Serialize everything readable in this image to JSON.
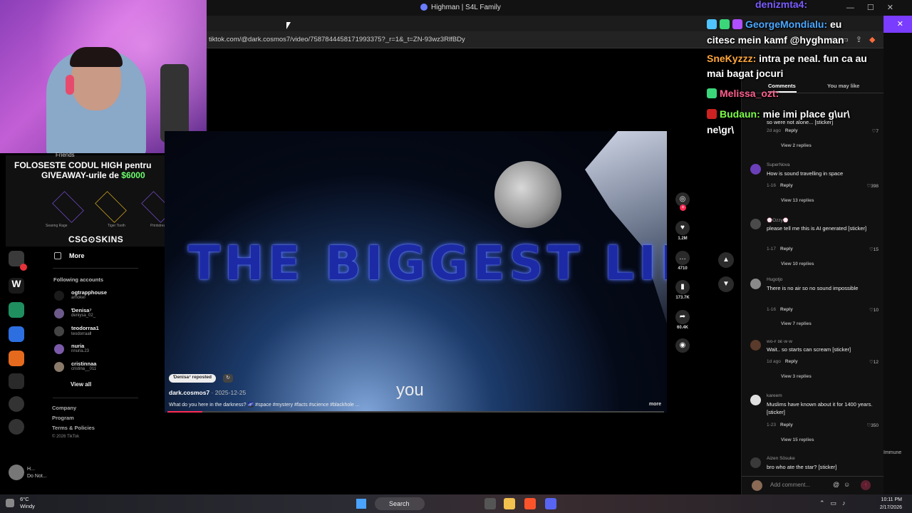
{
  "window": {
    "title": "Highman | S4L Family"
  },
  "browser": {
    "url": "tiktok.com/@dark.cosmos7/video/7587844458171993375?_r=1&_t=ZN-93wz3RlfBDy"
  },
  "giveaway": {
    "line1": "FOLOSESTE CODUL HIGH pentru",
    "line2_prefix": "GIVEAWAY-urile de ",
    "amount": "$6000",
    "items": [
      "Searing Rage",
      "Tiger Tooth",
      "Printstream"
    ],
    "brand": "CSG⊙SKINS"
  },
  "sidebar": {
    "friends": "Friends",
    "more": "More",
    "following_header": "Following accounts",
    "accounts": [
      {
        "name": "ogtrapphouse",
        "handle": "arhokel"
      },
      {
        "name": "Ɗenisa⁷",
        "handle": "deniysa_02_"
      },
      {
        "name": "teodorraa1",
        "handle": "teodorraaⅡ"
      },
      {
        "name": "nuria",
        "handle": "nnuria.23"
      },
      {
        "name": "cristinnaa",
        "handle": "cristina__011"
      }
    ],
    "view_all": "View all",
    "footer_links": [
      "Company",
      "Program",
      "Terms & Policies"
    ],
    "copyright": "© 2026 TikTok"
  },
  "video": {
    "overlay_title": "THE BIGGEST LIE",
    "subtitle": "you",
    "repost_chip": "Ɗenisa⁷ reposted",
    "author": "dark.cosmos7",
    "date": " · 2025-12-25",
    "caption": "What do you here in the darkness? 🌌 #space #mystery #facts #science #blackhole ...",
    "more": "more",
    "progress": 0.07
  },
  "actions": {
    "likes": "1.2M",
    "comments": "4710",
    "saves": "173.7K",
    "shares": "60.4K"
  },
  "comments_panel": {
    "tab_comments": "Comments",
    "tab_you_may_like": "You may like",
    "comments": [
      {
        "user": "",
        "text": "so were not alone... [sticker]",
        "meta": "2d ago",
        "reply": "Reply",
        "likes": "7",
        "view_replies": "View 2 replies"
      },
      {
        "user": "SuperNova",
        "text": "How is sound travelling in space",
        "meta": "1-16",
        "reply": "Reply",
        "likes": "398",
        "view_replies": "View 13 replies"
      },
      {
        "user": "💮Ozzy💮",
        "text": "please tell me this is AI generated [sticker]",
        "meta": "1-17",
        "reply": "Reply",
        "likes": "15",
        "view_replies": "View 10 replies"
      },
      {
        "user": "Hugotjo",
        "text": "There is no air so no sound impossible",
        "meta": "1-16",
        "reply": "Reply",
        "likes": "10",
        "view_replies": "View 7 replies"
      },
      {
        "user": "ᴡᴏ-ꜰ ᴅᴇ·ᴡ·ᴡ",
        "text": "Wait.. so starts can scream [sticker]",
        "meta": "1d ago",
        "reply": "Reply",
        "likes": "12",
        "view_replies": "View 3 replies"
      },
      {
        "user": "kareem",
        "text": "Muslims have known about it for 1400 years. [sticker]",
        "meta": "1-23",
        "reply": "Reply",
        "likes": "350",
        "view_replies": "View 15 replies"
      },
      {
        "user": "Aizen Sōsuke",
        "text": "bro who ate the star? [sticker]",
        "meta": "",
        "reply": "",
        "likes": "",
        "view_replies": ""
      }
    ],
    "add_comment_placeholder": "Add comment..."
  },
  "chat": {
    "top_name": "denizmta4:",
    "messages": [
      {
        "user": "GeorgeMondialu:",
        "text": " eu"
      },
      {
        "user": "",
        "text": "citesc mein kamf @hyghman"
      },
      {
        "user": "SneKyzzz:",
        "text": " intra pe neal. fun ca au"
      },
      {
        "user": "",
        "text": "mai bagat jocuri"
      },
      {
        "user": "Melissa_ozt:",
        "text": ""
      },
      {
        "user": "Budaun:",
        "text": " mie imi place g\\ur\\"
      },
      {
        "user": "",
        "text": "ne\\gr\\"
      }
    ]
  },
  "right_strip": {
    "immune": "Immune"
  },
  "desktop_user": {
    "name": "H...",
    "status": "Do Not..."
  },
  "taskbar": {
    "temp": "6°C",
    "condition": "Windy",
    "search": "Search",
    "time": "10:11 PM",
    "date": "2/17/2026"
  },
  "colors": {
    "tiktok_red": "#fe2c55",
    "giveaway_green": "#6cff6c",
    "chat_blue": "#4aa8ff",
    "chat_orange": "#ffa63a",
    "chat_pink": "#ff5f8d",
    "chat_green": "#7dff4a"
  }
}
